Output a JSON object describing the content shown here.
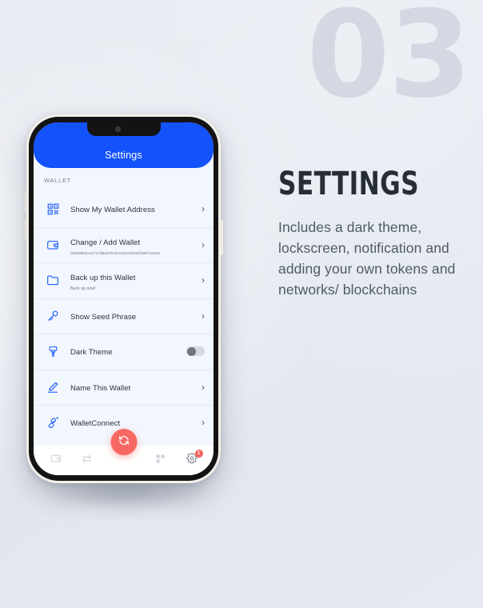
{
  "background": {
    "watermark_number": "03",
    "accent_blue": "#1452fb",
    "accent_red": "#f86863",
    "page_bg": "#e4e8ef",
    "watermark_color": "#d3d8e3"
  },
  "copy": {
    "title": "SETTINGS",
    "body": "Includes a dark theme, lockscreen, notification and adding your own tokens and networks/ blockchains"
  },
  "phone": {
    "header": {
      "title": "Settings"
    },
    "section_label": "WALLET",
    "rows": [
      {
        "icon": "qr-code-icon",
        "title": "Show My Wallet Address",
        "subtitle": "",
        "accessory": "chevron"
      },
      {
        "icon": "wallet-switch-icon",
        "title": "Change / Add Wallet",
        "subtitle": "0x9299b3A41727dBa6F57DA64E20E032f19673A6e6",
        "accessory": "chevron"
      },
      {
        "icon": "folder-icon",
        "title": "Back up this Wallet",
        "subtitle": "Back up now!",
        "accessory": "chevron"
      },
      {
        "icon": "key-icon",
        "title": "Show Seed Phrase",
        "subtitle": "",
        "accessory": "chevron"
      },
      {
        "icon": "paint-brush-icon",
        "title": "Dark Theme",
        "subtitle": "",
        "accessory": "toggle",
        "toggle_on": false
      },
      {
        "icon": "pencil-icon",
        "title": "Name This Wallet",
        "subtitle": "",
        "accessory": "chevron"
      },
      {
        "icon": "walletconnect-icon",
        "title": "WalletConnect",
        "subtitle": "",
        "accessory": "chevron"
      }
    ],
    "chevron_glyph": "›",
    "bottom_nav": {
      "items": [
        {
          "icon": "wallet-icon",
          "label": ""
        },
        {
          "icon": "swap-arrows-icon",
          "label": ""
        },
        {
          "icon": "grid-icon",
          "label": ""
        },
        {
          "icon": "gear-icon",
          "label": "",
          "badge": "1"
        }
      ],
      "fab_icon": "refresh-sync-icon"
    }
  }
}
